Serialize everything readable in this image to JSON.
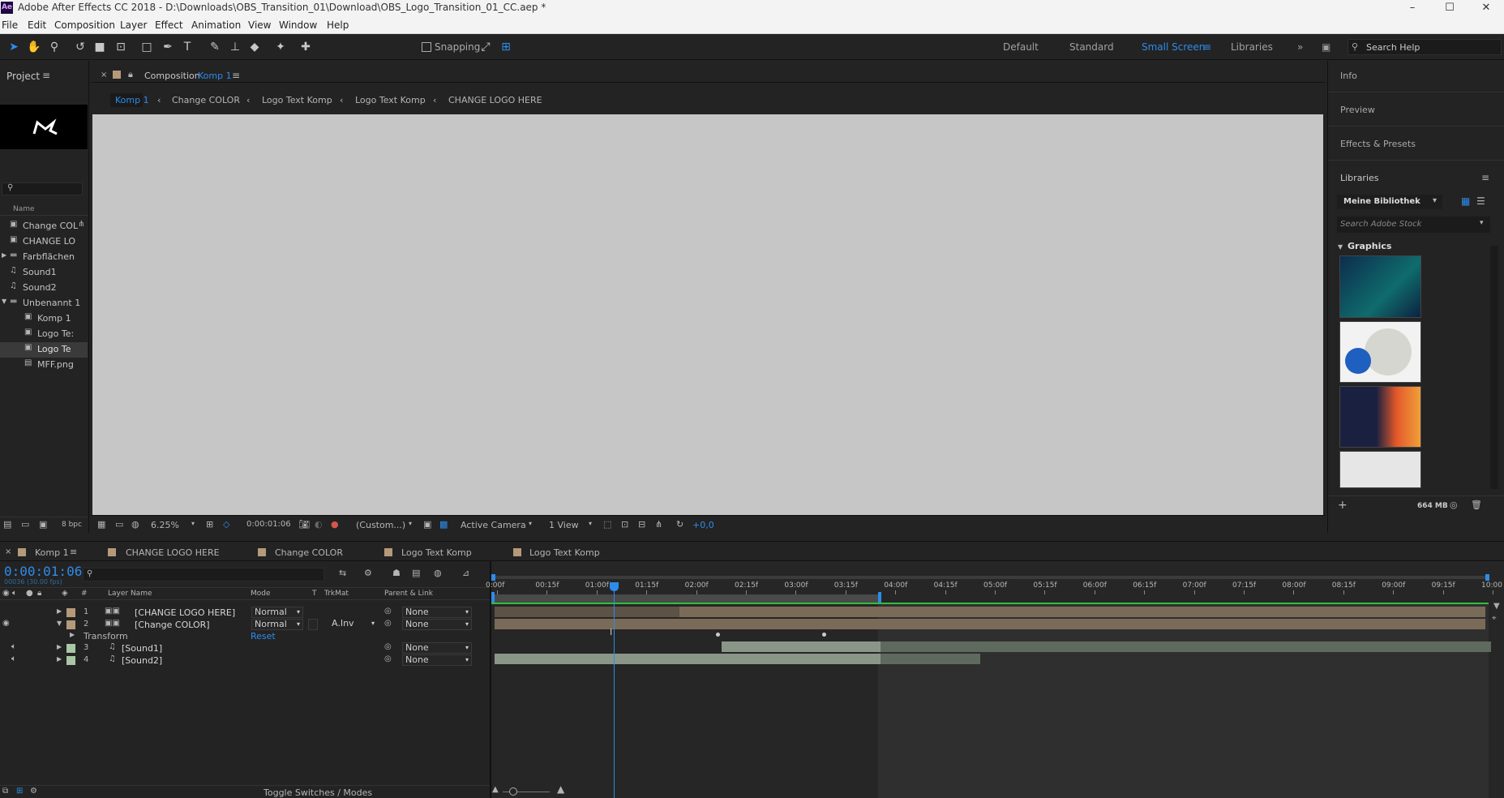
{
  "window": {
    "app_icon": "Ae",
    "title": "Adobe After Effects CC 2018 - D:\\Downloads\\OBS_Transition_01\\Download\\OBS_Logo_Transition_01_CC.aep *"
  },
  "menu": [
    "File",
    "Edit",
    "Composition",
    "Layer",
    "Effect",
    "Animation",
    "View",
    "Window",
    "Help"
  ],
  "toolbar": {
    "snapping_label": "Snapping",
    "workspaces": [
      "Default",
      "Standard",
      "Small Screen",
      "Libraries"
    ],
    "active_workspace": "Small Screen",
    "search_placeholder": "Search Help"
  },
  "project": {
    "title": "Project",
    "column_name": "Name",
    "bpc": "8 bpc",
    "items": [
      {
        "label": "Change COL",
        "icon": "comp-icon",
        "indent": 0
      },
      {
        "label": "CHANGE LO",
        "icon": "comp-icon",
        "indent": 0
      },
      {
        "label": "Farbflächen",
        "icon": "folder-icon",
        "indent": 0
      },
      {
        "label": "Sound1",
        "icon": "audio-icon",
        "indent": 0
      },
      {
        "label": "Sound2",
        "icon": "audio-icon",
        "indent": 0
      },
      {
        "label": "Unbenannt 1",
        "icon": "folder-icon",
        "indent": 0
      },
      {
        "label": "Komp 1",
        "icon": "comp-icon",
        "indent": 1
      },
      {
        "label": "Logo Te:",
        "icon": "comp-icon",
        "indent": 1
      },
      {
        "label": "Logo Te",
        "icon": "comp-icon",
        "indent": 1
      },
      {
        "label": "MFF.png",
        "icon": "image-icon",
        "indent": 1
      }
    ]
  },
  "composition": {
    "panel_label": "Composition",
    "comp_name": "Komp 1",
    "breadcrumbs": [
      "Komp 1",
      "Change COLOR",
      "Logo Text Komp",
      "Logo Text Komp",
      "CHANGE LOGO HERE"
    ],
    "footer": {
      "zoom": "6.25%",
      "timecode": "0:00:01:06",
      "resolution": "(Custom...)",
      "camera": "Active Camera",
      "views": "1 View",
      "exposure": "+0,0"
    }
  },
  "right_panels": {
    "info": "Info",
    "preview": "Preview",
    "effects": "Effects & Presets",
    "libraries": "Libraries",
    "library_name": "Meine Bibliothek",
    "stock_placeholder": "Search Adobe Stock",
    "graphics_label": "Graphics",
    "storage": "664 MB"
  },
  "timeline": {
    "tabs": [
      "Komp 1",
      "CHANGE LOGO HERE",
      "Change COLOR",
      "Logo Text Komp",
      "Logo Text Komp"
    ],
    "timecode": "0:00:01:06",
    "timecode_sub": "00036 (30.00 fps)",
    "columns": {
      "num": "#",
      "layer_name": "Layer Name",
      "mode": "Mode",
      "t": "T",
      "trkmat": "TrkMat",
      "parent": "Parent & Link"
    },
    "layers": [
      {
        "num": "1",
        "name": "[CHANGE LOGO HERE]",
        "mode": "Normal",
        "trkmat": "",
        "parent": "None"
      },
      {
        "num": "2",
        "name": "[Change COLOR]",
        "mode": "Normal",
        "trkmat": "A.Inv",
        "parent": "None"
      },
      {
        "num": "",
        "name": "Transform",
        "mode": "",
        "trkmat": "",
        "parent": ""
      },
      {
        "num": "3",
        "name": "[Sound1]",
        "mode": "",
        "trkmat": "",
        "parent": "None"
      },
      {
        "num": "4",
        "name": "[Sound2]",
        "mode": "",
        "trkmat": "",
        "parent": "None"
      }
    ],
    "reset_label": "Reset",
    "ruler": [
      "0:00f",
      "00:15f",
      "01:00f",
      "01:15f",
      "02:00f",
      "02:15f",
      "03:00f",
      "03:15f",
      "04:00f",
      "04:15f",
      "05:00f",
      "05:15f",
      "06:00f",
      "06:15f",
      "07:00f",
      "07:15f",
      "08:00f",
      "08:15f",
      "09:00f",
      "09:15f",
      "10:00"
    ],
    "toggle_label": "Toggle Switches / Modes"
  },
  "colors": {
    "accent": "#2d8ceb",
    "layer_tan": "#b59a79",
    "layer_audio": "#a9c6a6"
  }
}
